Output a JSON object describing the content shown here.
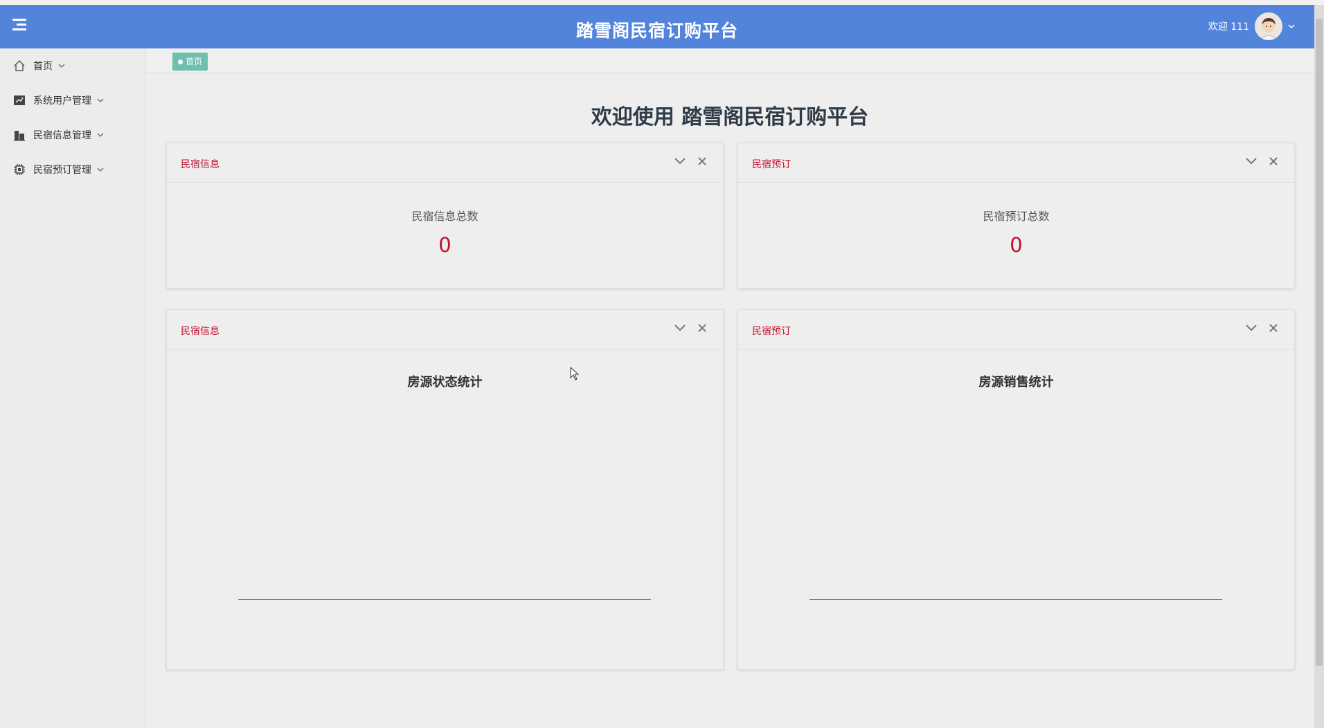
{
  "header": {
    "title": "踏雪阁民宿订购平台",
    "welcome": "欢迎 111"
  },
  "sidebar": {
    "items": [
      {
        "label": "首页",
        "icon": "home-icon"
      },
      {
        "label": "系统用户管理",
        "icon": "chart-icon"
      },
      {
        "label": "民宿信息管理",
        "icon": "building-icon"
      },
      {
        "label": "民宿预订管理",
        "icon": "chip-icon"
      }
    ]
  },
  "tabs": {
    "home": "首页"
  },
  "main": {
    "title": "欢迎使用 踏雪阁民宿订购平台"
  },
  "cards": [
    {
      "title": "民宿信息",
      "label": "民宿信息总数",
      "value": "0"
    },
    {
      "title": "民宿预订",
      "label": "民宿预订总数",
      "value": "0"
    }
  ],
  "charts": [
    {
      "title": "民宿信息",
      "chart_title": "房源状态统计"
    },
    {
      "title": "民宿预订",
      "chart_title": "房源销售统计"
    }
  ],
  "chart_data": [
    {
      "type": "bar",
      "title": "房源状态统计",
      "categories": [],
      "values": []
    },
    {
      "type": "bar",
      "title": "房源销售统计",
      "categories": [],
      "values": []
    }
  ],
  "colors": {
    "header": "#5384dc",
    "accent_red": "#c0102c",
    "tab_green": "#6fbfae"
  }
}
